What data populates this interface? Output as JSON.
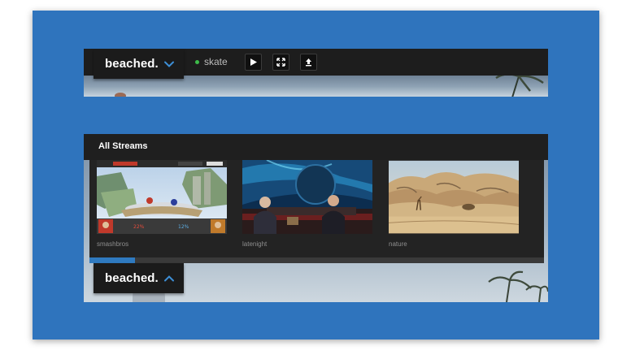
{
  "player": {
    "brand": "beached.",
    "stream_name": "skate",
    "status_color": "#3dbb49",
    "controls": [
      "play-icon",
      "fullscreen-icon",
      "upload-icon"
    ]
  },
  "streams_panel": {
    "title": "All Streams",
    "streams": [
      {
        "label": "smashbros"
      },
      {
        "label": "latenight"
      },
      {
        "label": "nature"
      }
    ],
    "scroll_progress": 0.1
  },
  "bottom_bar": {
    "brand": "beached."
  },
  "colors": {
    "accent": "#2f7ac0",
    "background": "#2f74bd",
    "bar": "#1d1d1d"
  }
}
